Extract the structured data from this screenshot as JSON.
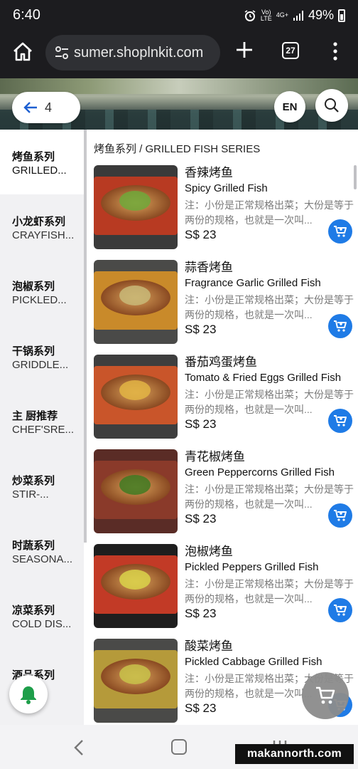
{
  "status_bar": {
    "time": "6:40",
    "network_top": "Vo)",
    "network_bottom": "LTE",
    "network_type": "4G+",
    "battery": "49%"
  },
  "browser": {
    "url": "sumer.shoplnkit.com",
    "tab_count": "27"
  },
  "header": {
    "back_count": "4",
    "language": "EN"
  },
  "sidebar": {
    "items": [
      {
        "zh": "烤鱼系列",
        "en": "GRILLED...",
        "active": true
      },
      {
        "zh": "小龙虾系列",
        "en": "CRAYFISH..."
      },
      {
        "zh": "泡椒系列",
        "en": "PICKLED..."
      },
      {
        "zh": "干锅系列",
        "en": "GRIDDLE..."
      },
      {
        "zh": "主 厨推荐",
        "en": "CHEF'SRE..."
      },
      {
        "zh": "炒菜系列",
        "en": "STIR-..."
      },
      {
        "zh": "时蔬系列",
        "en": "SEASONA..."
      },
      {
        "zh": "凉菜系列",
        "en": "COLD DIS..."
      },
      {
        "zh": "酒品系列",
        "en": ""
      }
    ]
  },
  "main": {
    "breadcrumb": "烤鱼系列 / GRILLED FISH SERIES",
    "items": [
      {
        "zh": "香辣烤鱼",
        "en": "Spicy Grilled Fish",
        "desc": "注：小份是正常规格出菜；大份是等于两份的规格，也就是一次叫...",
        "price": "S$ 23",
        "sauce": "#b83a22",
        "plate": "#3a3a3a",
        "garnish": "#6ea83a"
      },
      {
        "zh": "蒜香烤鱼",
        "en": "Fragrance Garlic Grilled Fish",
        "desc": "注：小份是正常规格出菜；大份是等于两份的规格，也就是一次叫...",
        "price": "S$ 23",
        "sauce": "#c98a2a",
        "plate": "#4a4a48",
        "garnish": "#c8b878"
      },
      {
        "zh": "番茄鸡蛋烤鱼",
        "en": "Tomato & Fried Eggs Grilled Fish",
        "desc": "注：小份是正常规格出菜；大份是等于两份的规格，也就是一次叫...",
        "price": "S$ 23",
        "sauce": "#c9552a",
        "plate": "#3e3e3e",
        "garnish": "#e2b444"
      },
      {
        "zh": "青花椒烤鱼",
        "en": "Green Peppercorns Grilled Fish",
        "desc": "注：小份是正常规格出菜；大份是等于两份的规格，也就是一次叫...",
        "price": "S$ 23",
        "sauce": "#8a3a2a",
        "plate": "#5a2c26",
        "garnish": "#3f7a22"
      },
      {
        "zh": "泡椒烤鱼",
        "en": "Pickled Peppers Grilled Fish",
        "desc": "注：小份是正常规格出菜；大份是等于两份的规格，也就是一次叫...",
        "price": "S$ 23",
        "sauce": "#c23a26",
        "plate": "#1e1e1e",
        "garnish": "#d9d24a"
      },
      {
        "zh": "酸菜烤鱼",
        "en": "Pickled Cabbage Grilled Fish",
        "desc": "注：小份是正常规格出菜；大份是等于两份的规格，也就是一次叫...",
        "price": "S$ 23",
        "sauce": "#b59a3a",
        "plate": "#4a4a48",
        "garnish": "#c8c24a"
      }
    ]
  },
  "watermark": "makannorth.com",
  "colors": {
    "accent": "#1f7be6",
    "status_bg": "#1c1c1f",
    "sidebar_bg": "#f1f1f3",
    "bell_green": "#1e9e4a"
  }
}
